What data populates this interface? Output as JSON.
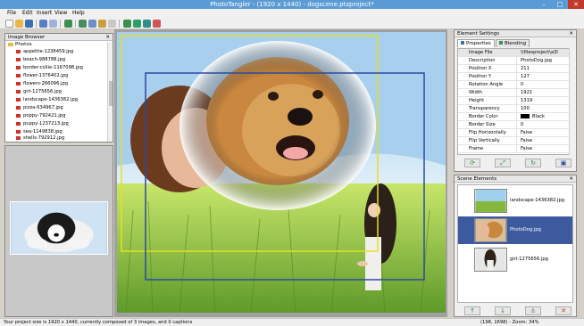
{
  "window": {
    "title": "PhotoTangler - (1920 x 1440) - dogscene.ptzproject*"
  },
  "menu": [
    "File",
    "Edit",
    "Insert",
    "View",
    "Help"
  ],
  "image_browser": {
    "title": "Image Browser",
    "root": "Photos",
    "files": [
      "appetite-1238459.jpg",
      "beach-988788.jpg",
      "border-collie-1167098.jpg",
      "flower-1376402.jpg",
      "flowers-266096.jpg",
      "girl-1275656.jpg",
      "landscape-1436382.jpg",
      "pizza-634967.jpg",
      "poppy-792421.jpg",
      "puppy-1237213.jpg",
      "sea-1149838.jpg",
      "shells-792912.jpg"
    ]
  },
  "element_settings": {
    "title": "Element Settings",
    "tabs": [
      "Properties",
      "Blending"
    ],
    "properties": [
      {
        "key": "Image File",
        "value": "\\\\filesproject\\a3l"
      },
      {
        "key": "Description",
        "value": "PhotoDog.jpg"
      },
      {
        "key": "Position X",
        "value": "211"
      },
      {
        "key": "Position Y",
        "value": "127"
      },
      {
        "key": "Rotation Angle",
        "value": "0"
      },
      {
        "key": "Width",
        "value": "1921"
      },
      {
        "key": "Height",
        "value": "1319"
      },
      {
        "key": "Transparency",
        "value": "100"
      },
      {
        "key": "Border Color",
        "value": "Black"
      },
      {
        "key": "Border Size",
        "value": "0"
      },
      {
        "key": "Flip Horizontally",
        "value": "False"
      },
      {
        "key": "Flip Vertically",
        "value": "False"
      },
      {
        "key": "Frame",
        "value": "False"
      }
    ]
  },
  "scene_elements": {
    "title": "Scene Elements",
    "items": [
      {
        "name": "landscape-1436382.jpg",
        "selected": false
      },
      {
        "name": "PhotoDog.jpg",
        "selected": true
      },
      {
        "name": "girl-1275656.jpg",
        "selected": false
      }
    ]
  },
  "status": {
    "left": "Your project size is 1920 x 1440, currently composed of 3 images, and 0 captions",
    "right": "(198, 1698) - Zoom: 34%"
  },
  "colors": {
    "titlebar": "#5b9bd5",
    "selection": "#3d5a9e",
    "frame_yellow": "#e8e020",
    "frame_blue": "#2a4aa0"
  }
}
